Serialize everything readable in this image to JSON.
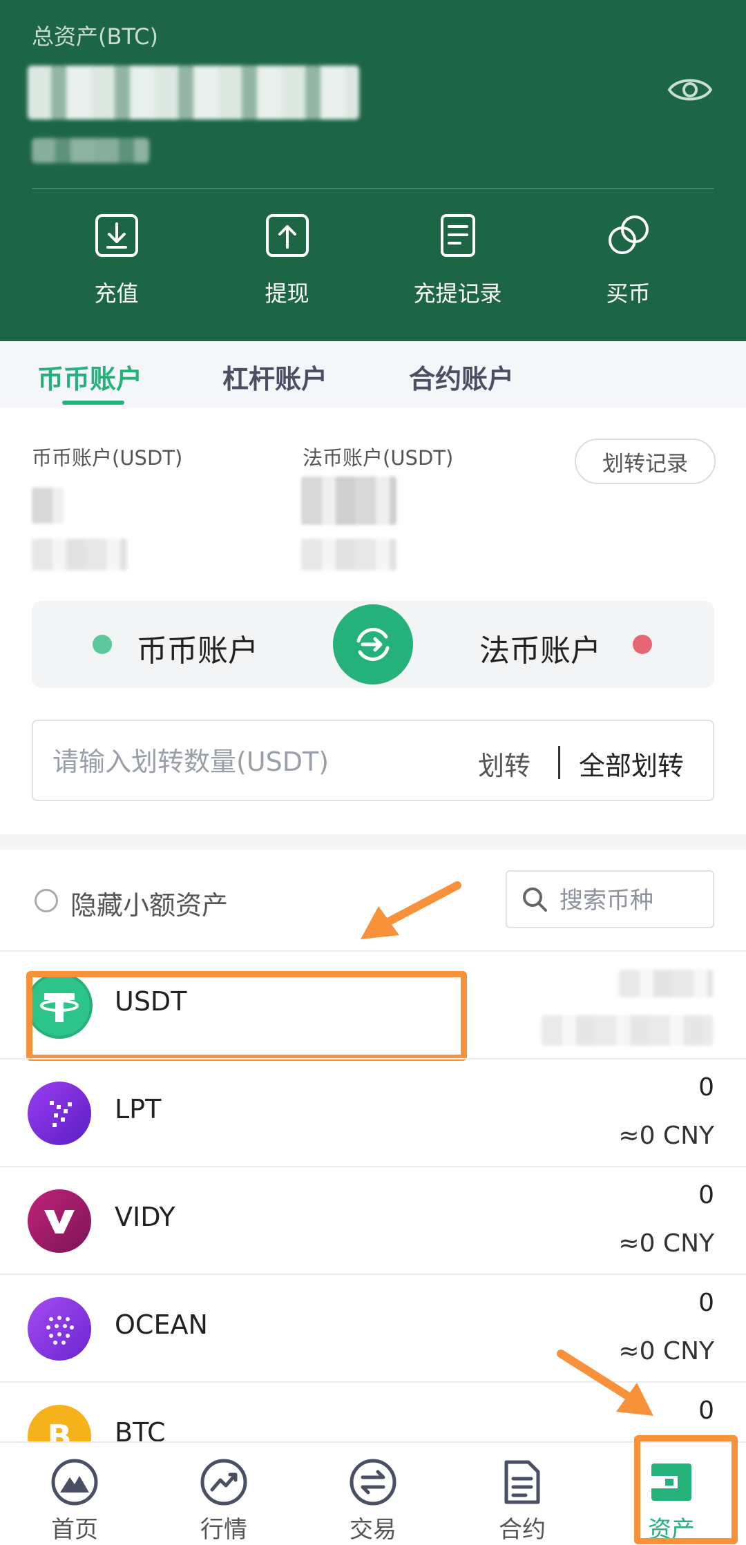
{
  "header": {
    "total_label": "总资产(BTC)",
    "actions": [
      {
        "label": "充值",
        "icon": "deposit-icon"
      },
      {
        "label": "提现",
        "icon": "withdraw-icon"
      },
      {
        "label": "充提记录",
        "icon": "records-icon"
      },
      {
        "label": "买币",
        "icon": "buy-coin-icon"
      }
    ]
  },
  "tabs": [
    {
      "label": "币币账户",
      "active": true
    },
    {
      "label": "杠杆账户",
      "active": false
    },
    {
      "label": "合约账户",
      "active": false
    }
  ],
  "balances": {
    "spot_label": "币币账户(USDT)",
    "fiat_label": "法币账户(USDT)",
    "record_button": "划转记录"
  },
  "transfer": {
    "from_account": "币币账户",
    "to_account": "法币账户",
    "input_placeholder": "请输入划转数量(USDT)",
    "transfer_button": "划转",
    "transfer_all_button": "全部划转"
  },
  "filter": {
    "hide_small_label": "隐藏小额资产",
    "search_placeholder": "搜索币种"
  },
  "coins": [
    {
      "name": "USDT",
      "amount": "",
      "cny": ""
    },
    {
      "name": "LPT",
      "amount": "0",
      "cny": "≈0 CNY"
    },
    {
      "name": "VIDY",
      "amount": "0",
      "cny": "≈0 CNY"
    },
    {
      "name": "OCEAN",
      "amount": "0",
      "cny": "≈0 CNY"
    },
    {
      "name": "BTC",
      "amount": "0",
      "cny": ""
    }
  ],
  "nav": [
    {
      "label": "首页",
      "icon": "home-icon"
    },
    {
      "label": "行情",
      "icon": "market-icon"
    },
    {
      "label": "交易",
      "icon": "trade-icon"
    },
    {
      "label": "合约",
      "icon": "contract-icon"
    },
    {
      "label": "资产",
      "icon": "assets-icon",
      "active": true
    }
  ],
  "colors": {
    "header_bg": "#1d6645",
    "accent": "#24b27a",
    "annotation": "#f7923b",
    "dot_from": "#5bc79a",
    "dot_to": "#e56773"
  }
}
